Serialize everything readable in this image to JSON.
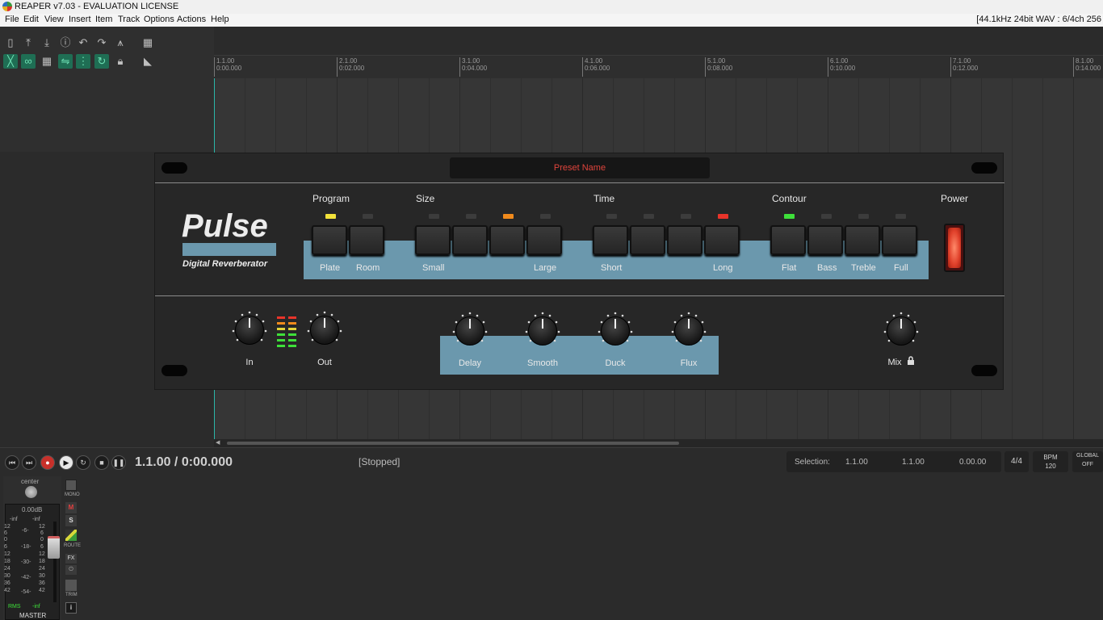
{
  "window": {
    "title": "REAPER v7.03 - EVALUATION LICENSE"
  },
  "menu": {
    "items": [
      "File",
      "Edit",
      "View",
      "Insert",
      "Item",
      "Track",
      "Options",
      "Actions",
      "Help"
    ],
    "status": "[44.1kHz 24bit WAV : 6/4ch 256"
  },
  "ruler": {
    "marks": [
      {
        "bar": "1.1.00",
        "time": "0:00.000"
      },
      {
        "bar": "2.1.00",
        "time": "0:02.000"
      },
      {
        "bar": "3.1.00",
        "time": "0:04.000"
      },
      {
        "bar": "4.1.00",
        "time": "0:06.000"
      },
      {
        "bar": "5.1.00",
        "time": "0:08.000"
      },
      {
        "bar": "6.1.00",
        "time": "0:10.000"
      },
      {
        "bar": "7.1.00",
        "time": "0:12.000"
      },
      {
        "bar": "8.1.00",
        "time": "0:14.000"
      }
    ]
  },
  "plugin": {
    "preset": "Preset Name",
    "logo": "Pulse",
    "subtitle": "Digital Reverberator",
    "groups": {
      "program": "Program",
      "size": "Size",
      "time": "Time",
      "contour": "Contour",
      "power": "Power"
    },
    "program_labels": [
      "Plate",
      "Room"
    ],
    "size_labels": {
      "left": "Small",
      "right": "Large"
    },
    "time_labels": {
      "left": "Short",
      "right": "Long"
    },
    "contour_labels": [
      "Flat",
      "Bass",
      "Treble",
      "Full"
    ],
    "leds": {
      "program": "yellow",
      "size": "orange",
      "time": "red",
      "contour": "green"
    },
    "colors": {
      "accent": "#6b98ad",
      "led_yellow": "#f2e23a",
      "led_orange": "#f08a1c",
      "led_red": "#e8342a",
      "led_green": "#3ee03a"
    },
    "knobs": {
      "in": "In",
      "out": "Out",
      "delay": "Delay",
      "smooth": "Smooth",
      "duck": "Duck",
      "flux": "Flux",
      "mix": "Mix"
    },
    "mix_icon": "lock-icon"
  },
  "transport": {
    "position": "1.1.00 / 0:00.000",
    "state": "[Stopped]",
    "selection": {
      "label": "Selection:",
      "start": "1.1.00",
      "end": "1.1.00",
      "length": "0.00.00"
    },
    "timesig": "4/4",
    "bpm_label": "BPM",
    "bpm": "120",
    "global_label": "GLOBAL",
    "global_value": "OFF"
  },
  "master": {
    "pan": "center",
    "volume": "0.00dB",
    "peak_l": "-inf",
    "peak_r": "-inf",
    "rms_label": "RMS",
    "rms_value": "-inf",
    "name": "MASTER",
    "scale": [
      "12",
      "6",
      "0",
      "6",
      "12",
      "18",
      "24",
      "30",
      "36",
      "42"
    ],
    "mid_scale": [
      "-6-",
      "-18-",
      "-30-",
      "-42-",
      "-54-"
    ],
    "buttons": {
      "mono": "MONO",
      "mute": "M",
      "solo": "S",
      "route": "ROUTE",
      "fx": "FX",
      "trim": "TRIM",
      "info": "i"
    }
  }
}
